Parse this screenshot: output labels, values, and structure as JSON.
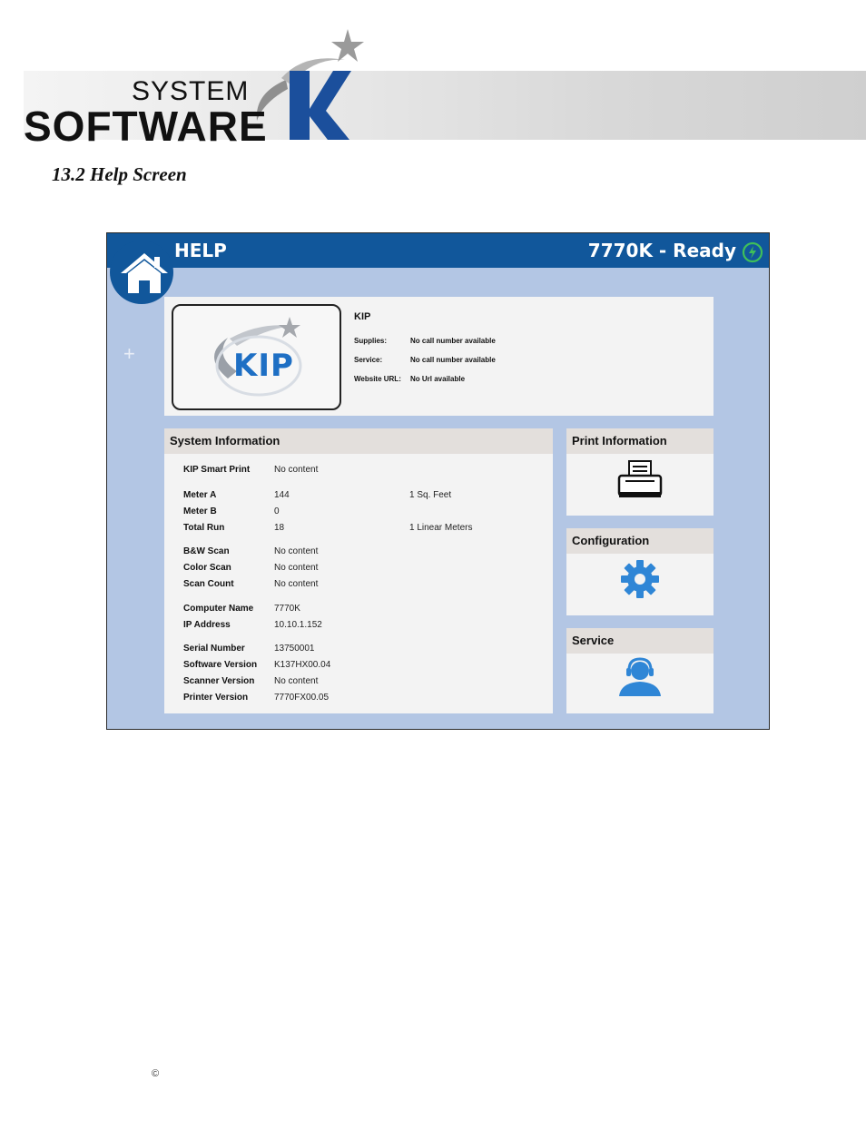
{
  "logo": {
    "system": "SYSTEM",
    "software": "SOFTWARE"
  },
  "section": {
    "title": "13.2 Help Screen"
  },
  "screen": {
    "title": "HELP",
    "status": "7770K - Ready",
    "kip": {
      "logo_text": "KIP",
      "name": "KIP",
      "rows": [
        {
          "label": "Supplies:",
          "value": "No call number available"
        },
        {
          "label": "Service:",
          "value": "No call number available"
        },
        {
          "label": "Website URL:",
          "value": "No Url available"
        }
      ]
    },
    "system_info": {
      "title": "System Information",
      "rows": [
        {
          "label": "KIP Smart Print",
          "value": "No content",
          "unit": ""
        },
        {
          "label": "Meter A",
          "value": "144",
          "unit": "1 Sq. Feet"
        },
        {
          "label": "Meter B",
          "value": "0",
          "unit": ""
        },
        {
          "label": "Total Run",
          "value": "18",
          "unit": "1 Linear Meters"
        },
        {
          "label": "B&W Scan",
          "value": "No content",
          "unit": ""
        },
        {
          "label": "Color Scan",
          "value": "No content",
          "unit": ""
        },
        {
          "label": "Scan Count",
          "value": "No content",
          "unit": ""
        },
        {
          "label": "Computer Name",
          "value": "7770K",
          "unit": ""
        },
        {
          "label": "IP Address",
          "value": "10.10.1.152",
          "unit": ""
        },
        {
          "label": "Serial Number",
          "value": "13750001",
          "unit": ""
        },
        {
          "label": "Software Version",
          "value": "K137HX00.04",
          "unit": ""
        },
        {
          "label": "Scanner Version",
          "value": "No content",
          "unit": ""
        },
        {
          "label": "Printer Version",
          "value": "7770FX00.05",
          "unit": ""
        }
      ]
    },
    "print_info": {
      "title": "Print Information",
      "icon": "printer-icon"
    },
    "configuration": {
      "title": "Configuration",
      "icon": "gear-icon"
    },
    "service": {
      "title": "Service",
      "icon": "support-agent-icon"
    }
  },
  "footer": {
    "copyright": "©"
  },
  "colors": {
    "topbar": "#11579b",
    "background": "#b3c6e4",
    "panel": "#f3f3f3",
    "panel_header": "#e3dfdc",
    "icon_blue": "#2f86d6",
    "ready_green": "#3fbf5a"
  }
}
